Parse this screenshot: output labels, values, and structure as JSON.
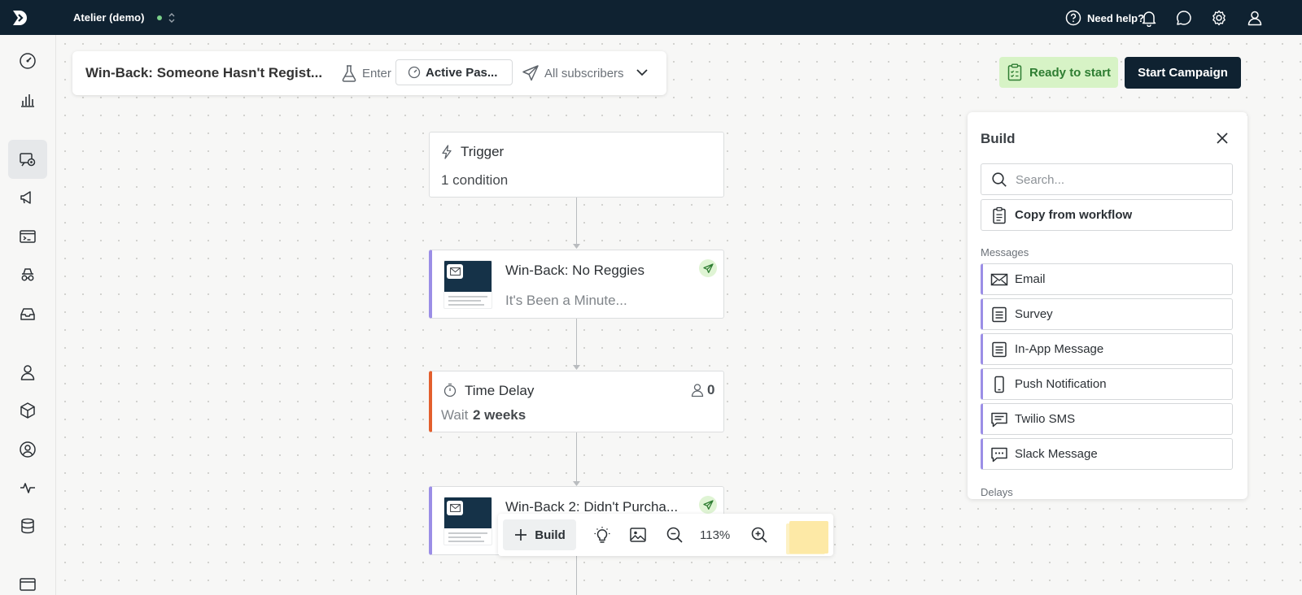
{
  "app": {
    "workspace_name": "Atelier (demo)",
    "help_label": "Need help?"
  },
  "campaign": {
    "title": "Win-Back: Someone Hasn't Regist...",
    "enter_label": "Enter",
    "audience_filter": "Active Pas...",
    "subscribers_label": "All subscribers",
    "status_label": "Ready to start",
    "start_button": "Start Campaign"
  },
  "flow": {
    "trigger": {
      "title": "Trigger",
      "subtitle": "1 condition"
    },
    "message1": {
      "title": "Win-Back: No Reggies",
      "subtitle": "It's Been a Minute..."
    },
    "delay": {
      "title": "Time Delay",
      "count": "0",
      "wait_prefix": "Wait",
      "wait_value": "2 weeks"
    },
    "message2": {
      "title": "Win-Back 2: Didn't Purcha..."
    }
  },
  "toolbar": {
    "build_label": "Build",
    "zoom_level": "113%"
  },
  "build_panel": {
    "title": "Build",
    "search_placeholder": "Search...",
    "copy_label": "Copy from workflow",
    "messages_section": "Messages",
    "items": [
      {
        "label": "Email",
        "icon": "envelope-icon"
      },
      {
        "label": "Survey",
        "icon": "survey-icon"
      },
      {
        "label": "In-App Message",
        "icon": "in-app-message-icon"
      },
      {
        "label": "Push Notification",
        "icon": "mobile-phone-icon"
      },
      {
        "label": "Twilio SMS",
        "icon": "sms-bubble-icon"
      },
      {
        "label": "Slack Message",
        "icon": "slack-bubble-icon"
      }
    ],
    "delays_section": "Delays"
  },
  "colors": {
    "topbar": "#0f2231",
    "message_accent": "#9b8ee6",
    "delay_accent": "#e35f2d",
    "ready_bg": "#d7f3c6",
    "ready_text": "#2e7d32"
  }
}
